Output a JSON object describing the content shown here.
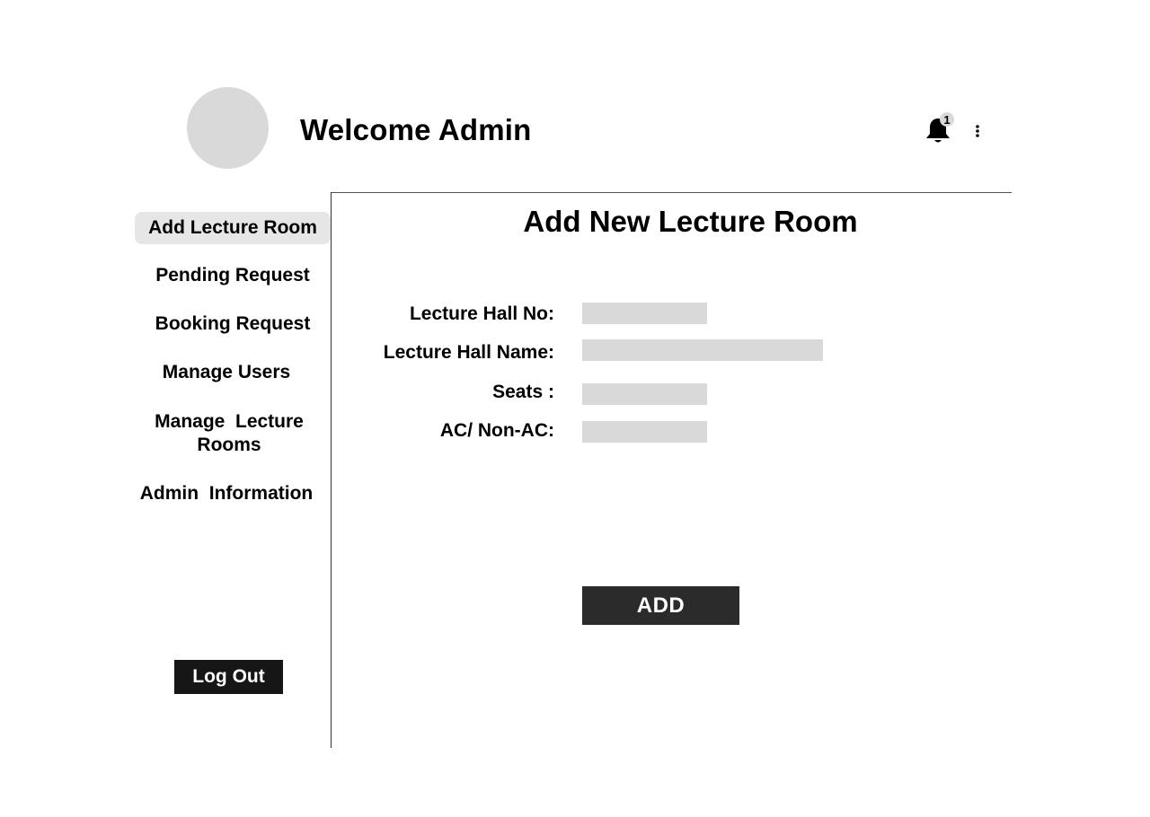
{
  "header": {
    "welcome": "Welcome Admin",
    "notification_count": "1",
    "bell_icon": "bell-icon",
    "menu_icon": "more-vertical-icon"
  },
  "sidebar": {
    "items": [
      {
        "label": "Add Lecture Room",
        "active": true
      },
      {
        "label": "Pending Request",
        "active": false
      },
      {
        "label": "Booking Request",
        "active": false
      },
      {
        "label": "Manage Users",
        "active": false
      },
      {
        "label": "Manage  Lecture Rooms",
        "active": false
      },
      {
        "label": "Admin  Information",
        "active": false
      }
    ],
    "logout_label": "Log Out"
  },
  "main": {
    "title": "Add New Lecture Room",
    "fields": [
      {
        "label": "Lecture Hall No:",
        "value": ""
      },
      {
        "label": "Lecture Hall Name:",
        "value": ""
      },
      {
        "label": "Seats :",
        "value": ""
      },
      {
        "label": "AC/ Non-AC:",
        "value": ""
      }
    ],
    "add_label": "ADD"
  },
  "colors": {
    "active_nav_bg": "#e6e6e6",
    "input_bg": "#d9d9d9",
    "add_button_bg": "#2b2b2b",
    "logout_bg": "#161616"
  }
}
